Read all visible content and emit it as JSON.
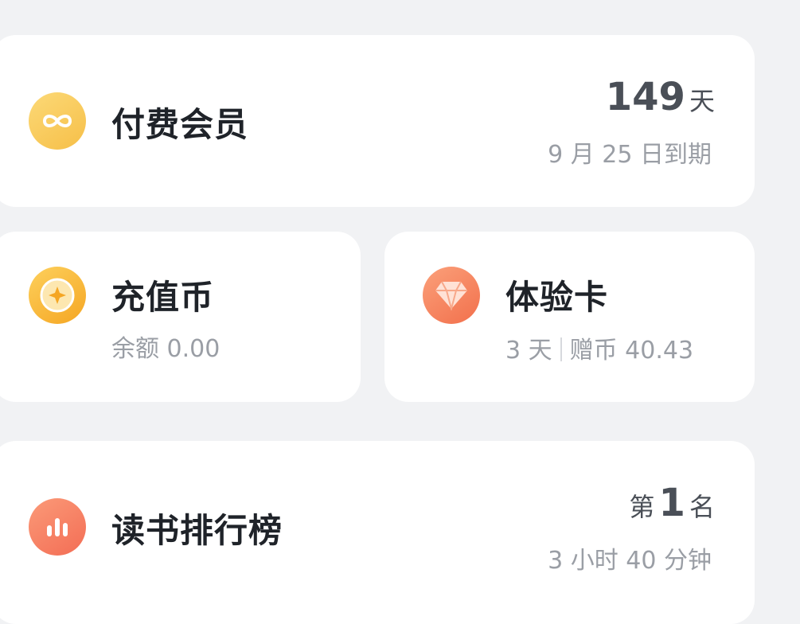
{
  "member": {
    "icon": "infinity-icon",
    "title": "付费会员",
    "days_value": "149",
    "days_unit": "天",
    "expiry": "9 月 25 日到期",
    "accent": "#f9c75a"
  },
  "coin": {
    "icon": "coin-icon",
    "title": "充值币",
    "balance": "余额 0.00",
    "accent": "#f8b62c"
  },
  "trial": {
    "icon": "diamond-icon",
    "title": "体验卡",
    "days": "3 天",
    "gift": "赠币 40.43",
    "accent": "#f8805f"
  },
  "rank": {
    "icon": "bar-chart-icon",
    "title": "读书排行榜",
    "rank_prefix": "第",
    "rank_value": "1",
    "rank_suffix": "名",
    "duration": "3 小时 40 分钟",
    "accent": "#f7785e"
  }
}
